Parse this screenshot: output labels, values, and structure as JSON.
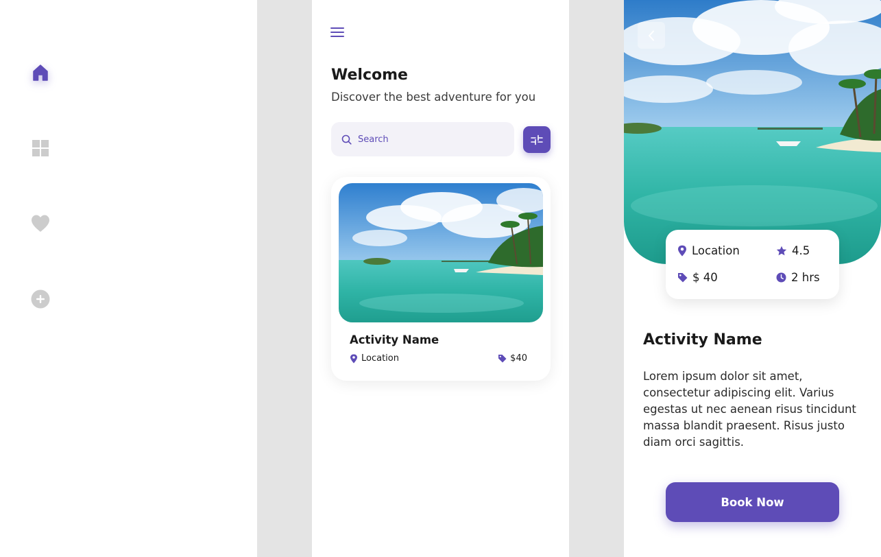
{
  "colors": {
    "accent": "#5e4cb7",
    "nav_inactive": "#cccccc",
    "gutter": "#e4e4e4",
    "search_background": "#f3f2f8"
  },
  "navigation": {
    "items": [
      {
        "icon": "home-icon",
        "active": true
      },
      {
        "icon": "grid-icon",
        "active": false
      },
      {
        "icon": "heart-icon",
        "active": false
      },
      {
        "icon": "add-circle-icon",
        "active": false
      }
    ]
  },
  "home": {
    "menu_icon": "hamburger-menu-icon",
    "title": "Welcome",
    "subtitle": "Discover the best adventure for you",
    "search": {
      "placeholder": "Search",
      "value": ""
    },
    "filter_icon": "sliders-icon",
    "card": {
      "name": "Activity Name",
      "location": "Location",
      "price": "$40"
    }
  },
  "detail": {
    "back_icon": "chevron-left-icon",
    "info": {
      "location": "Location",
      "rating": "4.5",
      "price": "$ 40",
      "duration": "2 hrs"
    },
    "name": "Activity Name",
    "description": "Lorem ipsum dolor sit amet, consectetur adipiscing elit. Varius egestas ut nec aenean risus tincidunt massa blandit praesent. Risus justo diam orci sagittis.",
    "book_label": "Book Now"
  }
}
